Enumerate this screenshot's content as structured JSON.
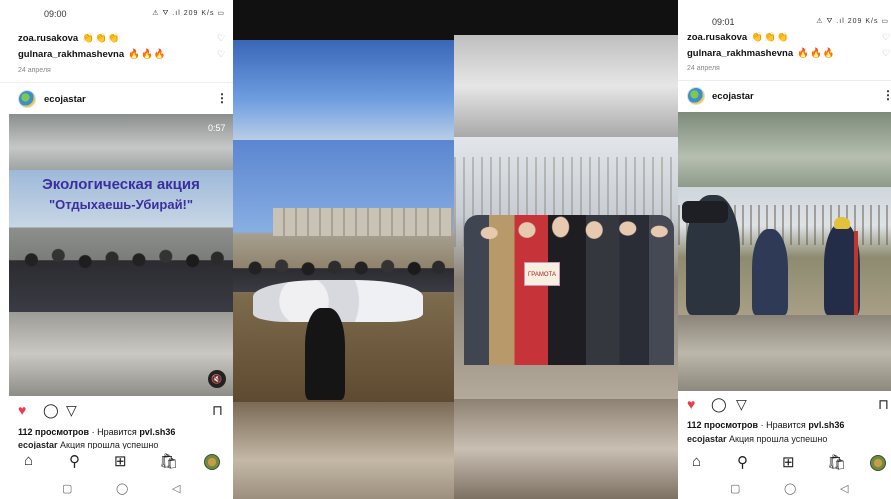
{
  "screens": {
    "left": {
      "status": {
        "time": "09:00",
        "status_icons": "⚠ ⛛ .ıl 209 K/s ▭"
      },
      "comments": [
        {
          "user": "zoa.rusakova",
          "reaction": "👏👏👏"
        },
        {
          "user": "gulnara_rakhmashevna",
          "reaction": "🔥🔥🔥"
        }
      ],
      "date": "24 апреля",
      "post": {
        "username": "ecojastar",
        "more": "⋮",
        "video_timer": "0:57",
        "banner_title": "Экологическая акция",
        "banner_subtitle": "\"Отдыхаешь-Убирай!\"",
        "mute_icon": "🔇"
      },
      "actions": {
        "like": "♥",
        "comment": "◯",
        "share": "▽",
        "save": "⊓"
      },
      "views": "112 просмотров",
      "likes_text": " · Нравится ",
      "liker": "pvl.sh36",
      "caption_user": "ecojastar",
      "caption_text": " Акция прошла успешно"
    },
    "right": {
      "status": {
        "time": "09:01",
        "status_icons": "⚠ ⛛ .ıl 209 K/s ▭"
      },
      "comments": [
        {
          "user": "zoa.rusakova",
          "reaction": "👏👏👏"
        },
        {
          "user": "gulnara_rakhmashevna",
          "reaction": "🔥🔥🔥"
        }
      ],
      "date": "24 апреля",
      "post": {
        "username": "ecojastar",
        "more": "⋮"
      },
      "actions": {
        "like": "♥",
        "comment": "◯",
        "share": "▽",
        "save": "⊓"
      },
      "views": "112 просмотров",
      "likes_text": " · Нравится ",
      "liker": "pvl.sh36",
      "caption_user": "ecojastar",
      "caption_text": " Акция прошла успешно"
    },
    "middle": {
      "sign_text": "ГРАМОТА"
    }
  },
  "navbar": {
    "home": "⌂",
    "search": "⚲",
    "add": "⊞",
    "shop": "🛍",
    "profile": ""
  },
  "system_nav": {
    "recents": "▢",
    "home": "◯",
    "back": "◁"
  },
  "colors": {
    "like_red": "#ed3b4c",
    "banner_purple": "#3b2fa0"
  }
}
